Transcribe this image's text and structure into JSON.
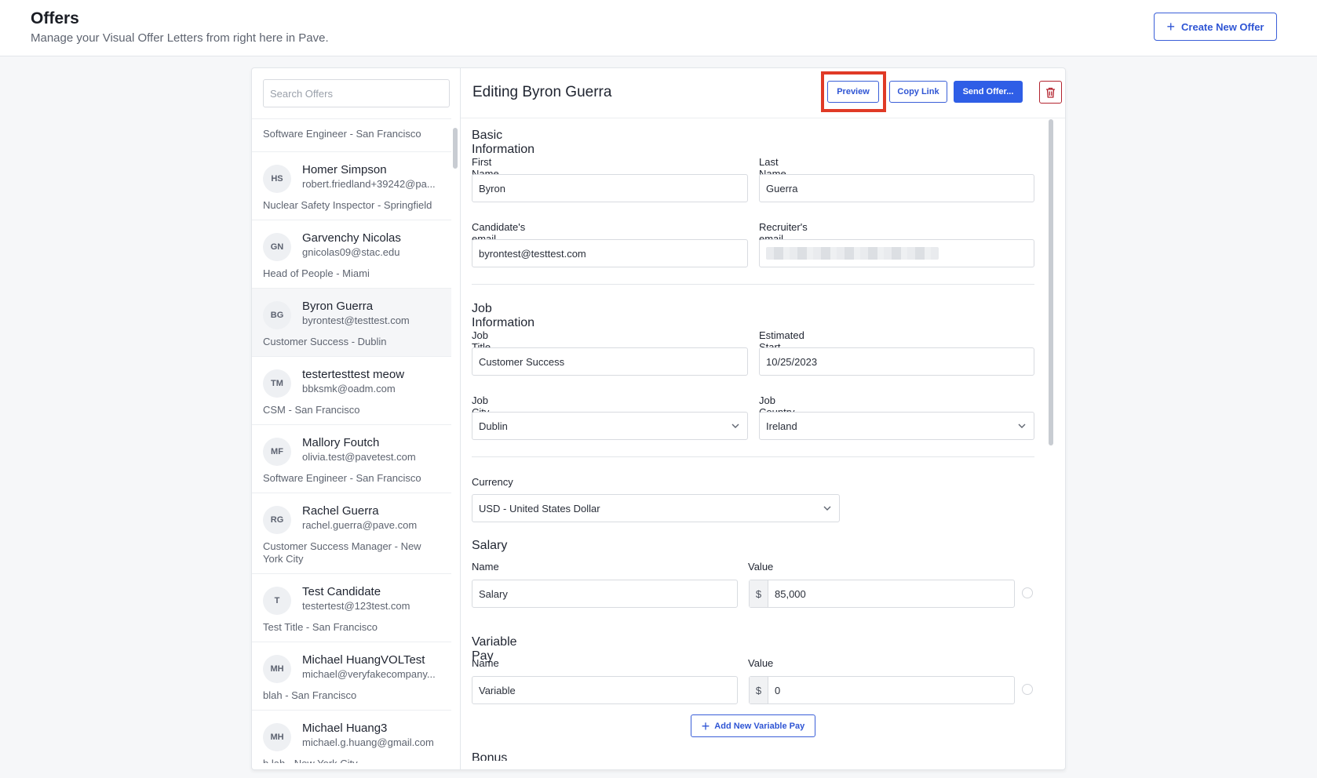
{
  "header": {
    "title": "Offers",
    "subtitle": "Manage your Visual Offer Letters from right here in Pave.",
    "create_button": "Create New Offer"
  },
  "sidebar": {
    "search_placeholder": "Search Offers",
    "partial_item_role": "Software Engineer - San Francisco",
    "offers": [
      {
        "initials": "HS",
        "name": "Homer Simpson",
        "email": "robert.friedland+39242@pa...",
        "role": "Nuclear Safety Inspector - Springfield"
      },
      {
        "initials": "GN",
        "name": "Garvenchy Nicolas",
        "email": "gnicolas09@stac.edu",
        "role": "Head of People - Miami"
      },
      {
        "initials": "BG",
        "name": "Byron Guerra",
        "email": "byrontest@testtest.com",
        "role": "Customer Success - Dublin"
      },
      {
        "initials": "TM",
        "name": "testertesttest meow",
        "email": "bbksmk@oadm.com",
        "role": "CSM - San Francisco"
      },
      {
        "initials": "MF",
        "name": "Mallory Foutch",
        "email": "olivia.test@pavetest.com",
        "role": "Software Engineer - San Francisco"
      },
      {
        "initials": "RG",
        "name": "Rachel Guerra",
        "email": "rachel.guerra@pave.com",
        "role": "Customer Success Manager - New York City"
      },
      {
        "initials": "T",
        "name": "Test Candidate",
        "email": "testertest@123test.com",
        "role": "Test Title - San Francisco"
      },
      {
        "initials": "MH",
        "name": "Michael HuangVOLTest",
        "email": "michael@veryfakecompany...",
        "role": "blah - San Francisco"
      },
      {
        "initials": "MH",
        "name": "Michael Huang3",
        "email": "michael.g.huang@gmail.com",
        "role": "b lah - New York City"
      }
    ]
  },
  "editor": {
    "title": "Editing Byron Guerra",
    "preview_button": "Preview",
    "copy_link_button": "Copy Link",
    "send_button": "Send Offer...",
    "basic_info": {
      "title": "Basic Information",
      "first_name_label": "First Name",
      "first_name": "Byron",
      "last_name_label": "Last Name",
      "last_name": "Guerra",
      "candidate_email_label": "Candidate's email",
      "candidate_email": "byrontest@testtest.com",
      "recruiter_email_label": "Recruiter's email"
    },
    "job_info": {
      "title": "Job Information",
      "job_title_label": "Job Title",
      "job_title": "Customer Success",
      "start_date_label": "Estimated Start Date",
      "start_date": "10/25/2023",
      "job_city_label": "Job City",
      "job_city": "Dublin",
      "job_country_label": "Job Country",
      "job_country": "Ireland"
    },
    "currency": {
      "label": "Currency",
      "value": "USD - United States Dollar"
    },
    "salary": {
      "title": "Salary",
      "name_label": "Name",
      "value_label": "Value",
      "name": "Salary",
      "symbol": "$",
      "value": "85,000"
    },
    "variable_pay": {
      "title": "Variable Pay",
      "name_label": "Name",
      "value_label": "Value",
      "name": "Variable",
      "symbol": "$",
      "value": "0",
      "add_button": "Add New Variable Pay"
    },
    "next_section_title": "Bonus"
  },
  "colors": {
    "accent": "#2f5ee6",
    "highlight": "#e03a26",
    "danger": "#b3242f"
  }
}
